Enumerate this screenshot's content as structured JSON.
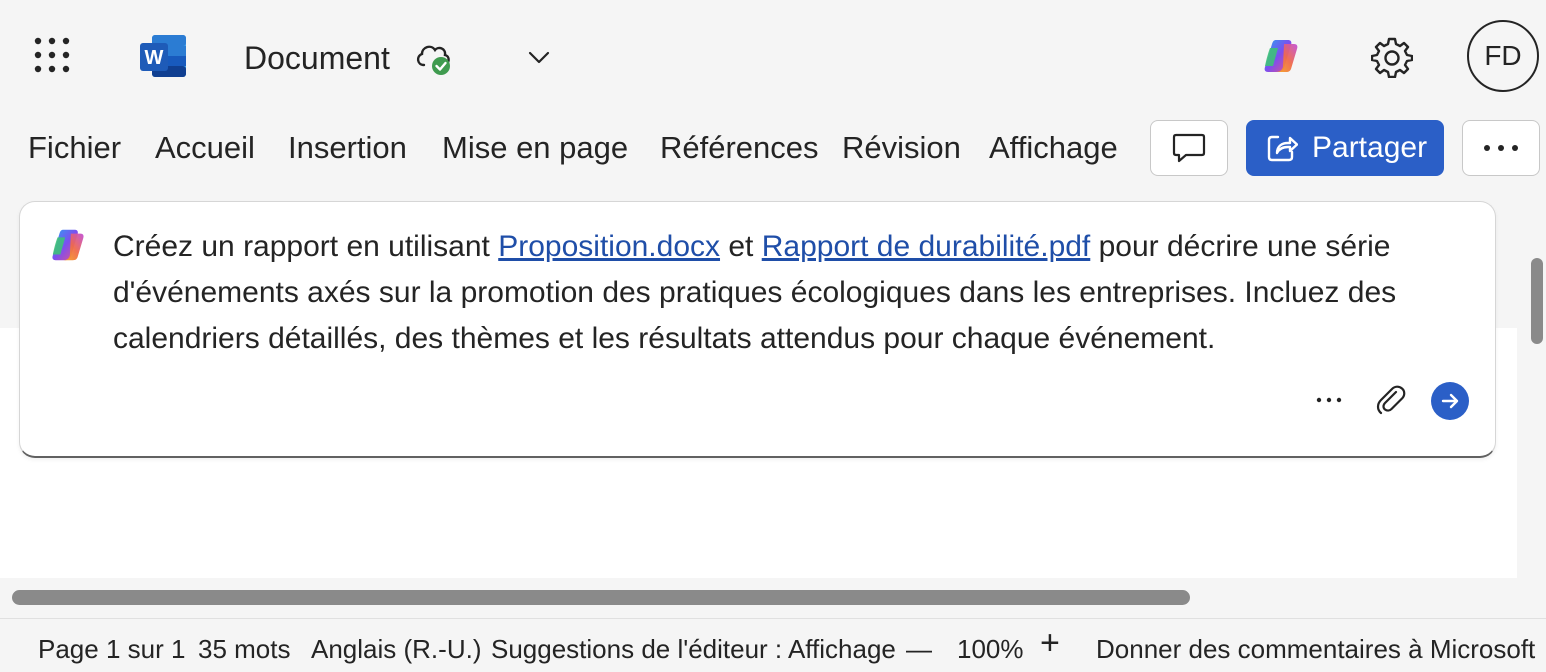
{
  "titlebar": {
    "doc_title": "Document",
    "avatar_initials": "FD"
  },
  "ribbon": {
    "tabs": [
      "Fichier",
      "Accueil",
      "Insertion",
      "Mise en page",
      "Références",
      "Révision",
      "Affichage"
    ],
    "share_label": "Partager"
  },
  "copilot_prompt": {
    "text_1": "Créez un rapport en utilisant ",
    "link_1": "Proposition.docx",
    "text_2": " et ",
    "link_2": "Rapport de durabilité.pdf",
    "text_3": " pour décrire une série d'événements axés sur la promotion des pratiques écologiques dans les entreprises. Incluez des calendriers détaillés, des thèmes et les résultats attendus pour chaque événement.",
    "more_label": "···"
  },
  "statusbar": {
    "page": "Page 1 sur 1",
    "words": "35 mots",
    "language": "Anglais (R.-U.)",
    "editor": "Suggestions de l'éditeur : Affichage",
    "zoom_out": "—",
    "zoom": "100%",
    "zoom_in": "+",
    "feedback": "Donner des commentaires à Microsoft"
  },
  "colors": {
    "accent": "#2b5fc7",
    "link": "#1f4ea8",
    "cloud_check": "#3f9b4f",
    "word_logo": "#1e5bb8"
  },
  "icons": [
    "app-launcher-icon",
    "word-logo-icon",
    "cloud-saved-icon",
    "chevron-down-icon",
    "copilot-icon",
    "gear-icon",
    "comment-icon",
    "share-icon",
    "more-icon",
    "attach-icon",
    "send-arrow-icon"
  ]
}
